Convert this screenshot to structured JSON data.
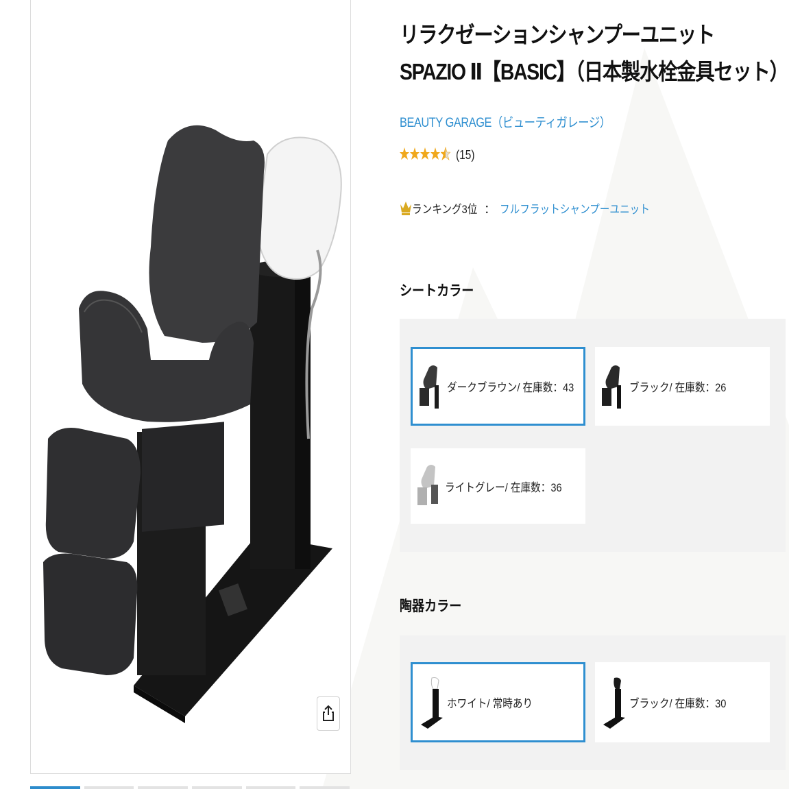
{
  "product": {
    "title": "リラクゼーションシャンプーユニット SPAZIO Ⅱ【BASIC】（日本製水栓金具セット）",
    "brand": "BEAUTY GARAGE（ビューティガレージ）",
    "rating": 4.5,
    "review_count": "(15)",
    "ranking_label": "ランキング3位",
    "ranking_sep": "：",
    "ranking_category": "フルフラットシャンプーユニット"
  },
  "gallery": {
    "share_icon": "share-icon",
    "thumbnail_count": 6,
    "active_thumbnail": 0
  },
  "seat_color": {
    "title": "シートカラー",
    "options": [
      {
        "label": "ダークブラウン/ 在庫数：43",
        "selected": true,
        "swatch": "#3a3a3a"
      },
      {
        "label": "ブラック/ 在庫数：26",
        "selected": false,
        "swatch": "#2a2a2a"
      },
      {
        "label": "ライトグレー/ 在庫数：36",
        "selected": false,
        "swatch": "#bdbdbd"
      }
    ]
  },
  "ceramic_color": {
    "title": "陶器カラー",
    "options": [
      {
        "label": "ホワイト/ 常時あり",
        "selected": true,
        "swatch": "#ffffff"
      },
      {
        "label": "ブラック/ 在庫数：30",
        "selected": false,
        "swatch": "#1a1a1a"
      }
    ]
  },
  "colors": {
    "accent": "#2f8fd0",
    "panel_bg": "#f2f2f2",
    "star": "#f0a81c",
    "crown": "#d9a920"
  }
}
